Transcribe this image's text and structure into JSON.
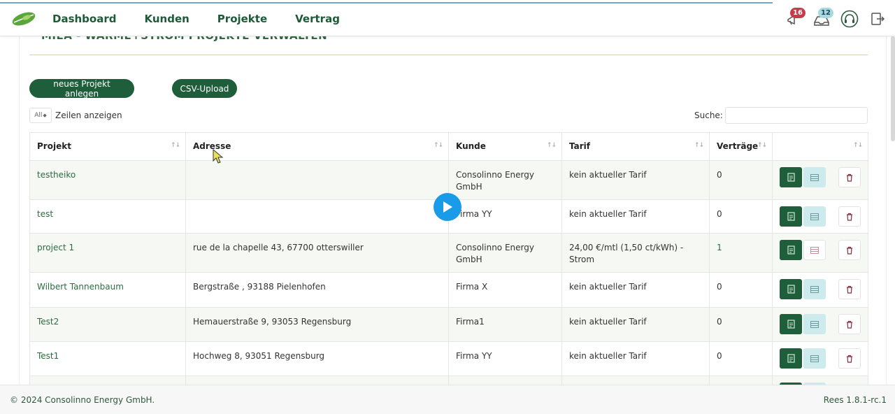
{
  "nav": {
    "items": [
      "Dashboard",
      "Kunden",
      "Projekte",
      "Vertrag"
    ],
    "badges": {
      "notifications": "16",
      "messages": "12"
    }
  },
  "page": {
    "heading": "MIEA - WÄRME+STROM PROJEKTE VERWALTEN",
    "new_project_button": "neues Projekt anlegen",
    "csv_upload_button": "CSV-Upload",
    "length_select_value": "All",
    "length_label": "Zeilen anzeigen",
    "search_label": "Suche:",
    "search_value": ""
  },
  "table": {
    "columns": [
      "Projekt",
      "Adresse",
      "Kunde",
      "Tarif",
      "Verträge",
      ""
    ],
    "rows": [
      {
        "projekt": "testheiko",
        "adresse": "",
        "kunde": "Consolinno Energy GmbH",
        "tarif": "kein aktueller Tarif",
        "vertraege": "0"
      },
      {
        "projekt": "test",
        "adresse": "",
        "kunde": "Firma YY",
        "tarif": "kein aktueller Tarif",
        "vertraege": "0"
      },
      {
        "projekt": "project 1",
        "adresse": "rue de la chapelle 43, 67700 otterswiller",
        "kunde": "Consolinno Energy GmbH",
        "tarif": "24,00 €/mtl (1,50 ct/kWh) - Strom",
        "vertraege": "1"
      },
      {
        "projekt": "Wilbert Tannenbaum",
        "adresse": "Bergstraße , 93188 Pielenhofen",
        "kunde": "Firma X",
        "tarif": "kein aktueller Tarif",
        "vertraege": "0"
      },
      {
        "projekt": "Test2",
        "adresse": "Hemauerstraße 9, 93053 Regensburg",
        "kunde": "Firma1",
        "tarif": "kein aktueller Tarif",
        "vertraege": "0"
      },
      {
        "projekt": "Test1",
        "adresse": "Hochweg 8, 93051 Regensburg",
        "kunde": "Firma YY",
        "tarif": "kein aktueller Tarif",
        "vertraege": "0"
      }
    ]
  },
  "footer": {
    "copyright": "© 2024 Consolinno Energy GmbH.",
    "version": "Rees 1.8.1-rc.1"
  },
  "colors": {
    "brand": "#1f5e3a",
    "accent_teal": "#cdeaec",
    "badge_red": "#c83a4a"
  }
}
